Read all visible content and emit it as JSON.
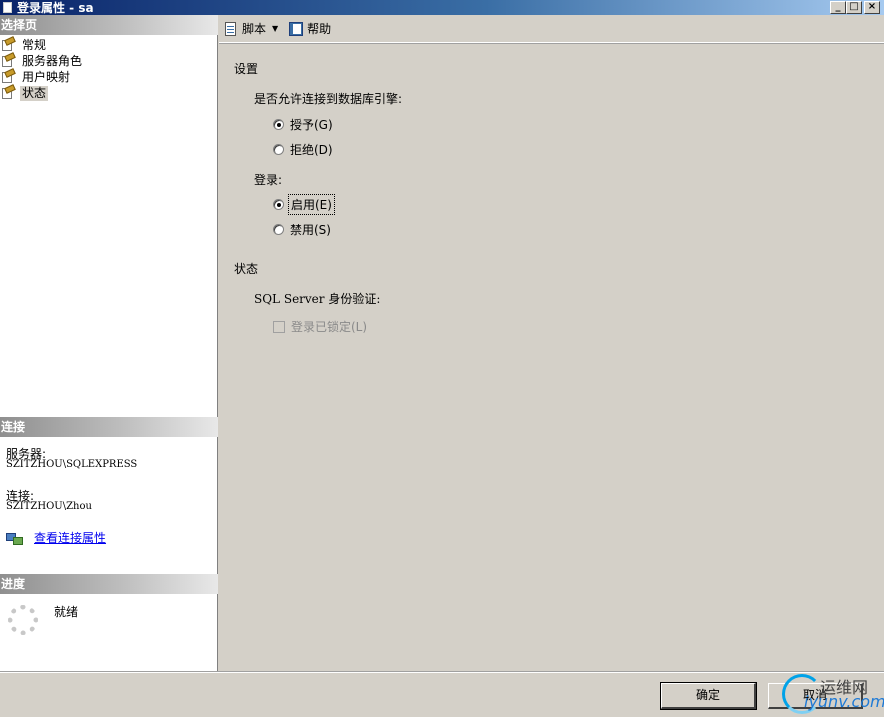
{
  "window": {
    "title": "登录属性 - sa",
    "buttons": {
      "minimize": "_",
      "maximize": "□",
      "close": "×"
    }
  },
  "left": {
    "select_page_header": "选择页",
    "pages": [
      {
        "label": "常规",
        "selected": false
      },
      {
        "label": "服务器角色",
        "selected": false
      },
      {
        "label": "用户映射",
        "selected": false
      },
      {
        "label": "状态",
        "selected": true
      }
    ],
    "connection_header": "连接",
    "server_label": "服务器:",
    "server_value": "SZITZHOU\\SQLEXPRESS",
    "connection_label": "连接:",
    "connection_value": "SZITZHOU\\Zhou",
    "view_connection_link": "查看连接属性",
    "progress_header": "进度",
    "progress_status": "就绪"
  },
  "toolbar": {
    "script_label": "脚本",
    "help_label": "帮助"
  },
  "form": {
    "settings_heading": "设置",
    "permission_question": "是否允许连接到数据库引擎:",
    "grant_label": "授予(G)",
    "deny_label": "拒绝(D)",
    "permission_selected": "grant",
    "login_label": "登录:",
    "enabled_label": "启用(E)",
    "disabled_label": "禁用(S)",
    "login_selected": "enabled",
    "status_heading": "状态",
    "sql_auth_label": "SQL Server 身份验证:",
    "locked_out_label": "登录已锁定(L)",
    "locked_out_checked": false
  },
  "footer": {
    "ok_label": "确定",
    "cancel_label": "取消"
  },
  "watermark": {
    "top_text": "运维网",
    "bottom_text": "iyunv.com"
  }
}
